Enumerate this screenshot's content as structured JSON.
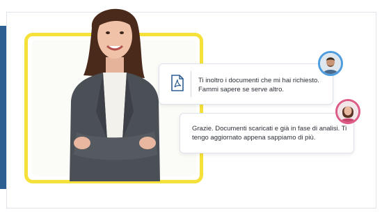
{
  "colors": {
    "accent_blue": "#2e5f93",
    "frame_yellow": "#f6e13a",
    "avatar_ring_blue": "#4d9ce0",
    "avatar_ring_pink": "#de5b86"
  },
  "chat": {
    "messages": [
      {
        "text": "Ti inoltro i documenti che mi hai richiesto. Fammi sapere se serve altro.",
        "icon": "pdf-document-icon",
        "avatar": "male-user-avatar"
      },
      {
        "text": "Grazie. Documenti scaricati e già in fase di analisi. Ti tengo aggiornato appena sappiamo di più.",
        "avatar": "female-user-avatar"
      }
    ]
  }
}
